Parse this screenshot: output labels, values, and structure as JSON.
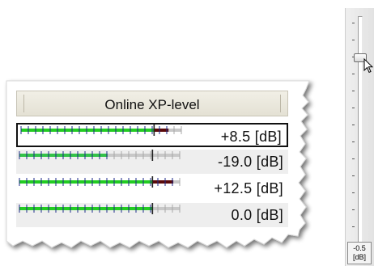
{
  "panel": {
    "title": "Online XP-level",
    "rows": [
      {
        "value_label": "+8.5 [dB]",
        "level_fraction": 0.92,
        "peak_fraction": 0.83,
        "selected": true,
        "disabled": false
      },
      {
        "value_label": "-19.0 [dB]",
        "level_fraction": 0.55,
        "peak_fraction": 0.83,
        "selected": false,
        "disabled": true
      },
      {
        "value_label": "+12.5 [dB]",
        "level_fraction": 0.96,
        "peak_fraction": 0.83,
        "selected": false,
        "disabled": false
      },
      {
        "value_label": "0.0 [dB]",
        "level_fraction": 0.83,
        "peak_fraction": 0.83,
        "selected": false,
        "disabled": false
      }
    ]
  },
  "fader": {
    "value_label": "-0.5",
    "unit_label": "[dB]",
    "level_fraction": 0.82
  },
  "colors": {
    "meter_green": "#22cc22",
    "meter_over": "#5a0a0a",
    "meter_unlit": "#c8c8c8",
    "tick_color": "#1e2a8a"
  },
  "icons": {
    "cursor": "mouse-pointer-icon",
    "fader_thumb": "fader-thumb-icon"
  }
}
